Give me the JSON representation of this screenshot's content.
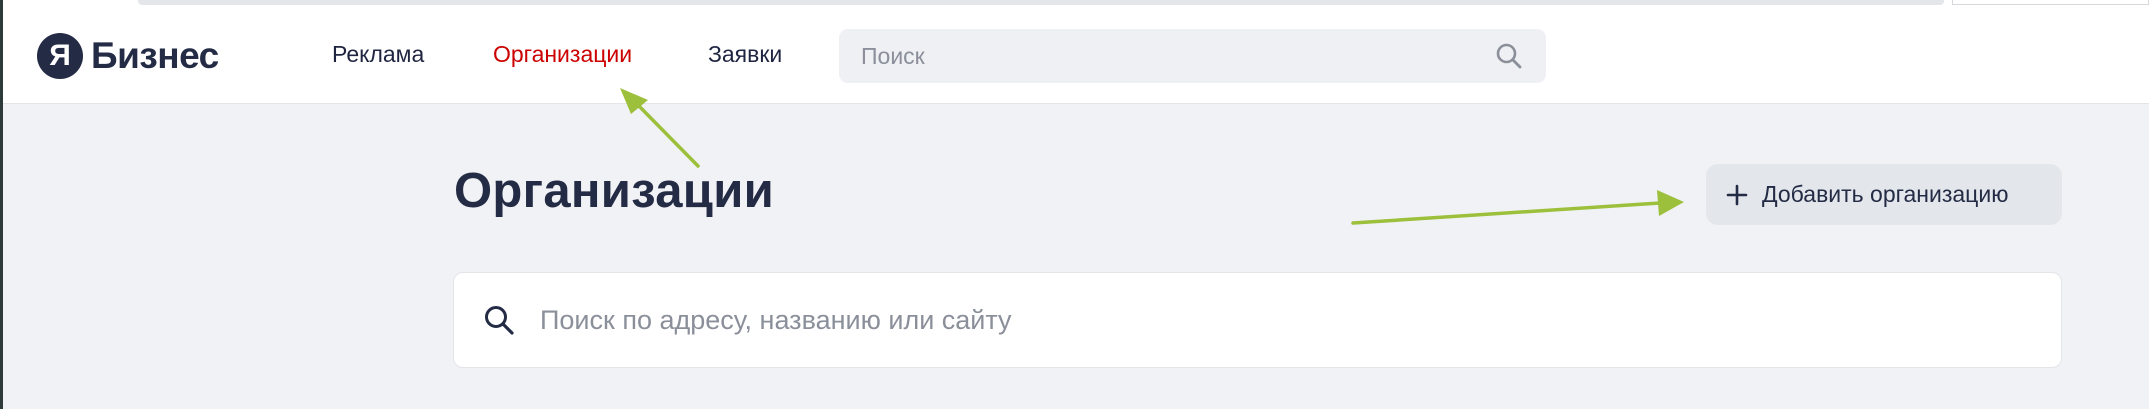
{
  "header": {
    "logo": {
      "mark": "Я",
      "text": "Бизнес"
    },
    "nav": [
      {
        "label": "Реклама",
        "active": false
      },
      {
        "label": "Организации",
        "active": true
      },
      {
        "label": "Заявки",
        "active": false
      }
    ],
    "search": {
      "placeholder": "Поиск",
      "icon": "search-icon"
    }
  },
  "main": {
    "title": "Организации",
    "add_button": {
      "icon": "plus-icon",
      "label": "Добавить организацию"
    },
    "search": {
      "placeholder": "Поиск по адресу, названию или сайту",
      "icon": "search-icon"
    }
  },
  "annotations": {
    "arrow_color": "#9cc03b"
  },
  "colors": {
    "active_nav": "#cc0000",
    "brand_dark": "#232b45",
    "page_bg": "#f1f2f5"
  }
}
